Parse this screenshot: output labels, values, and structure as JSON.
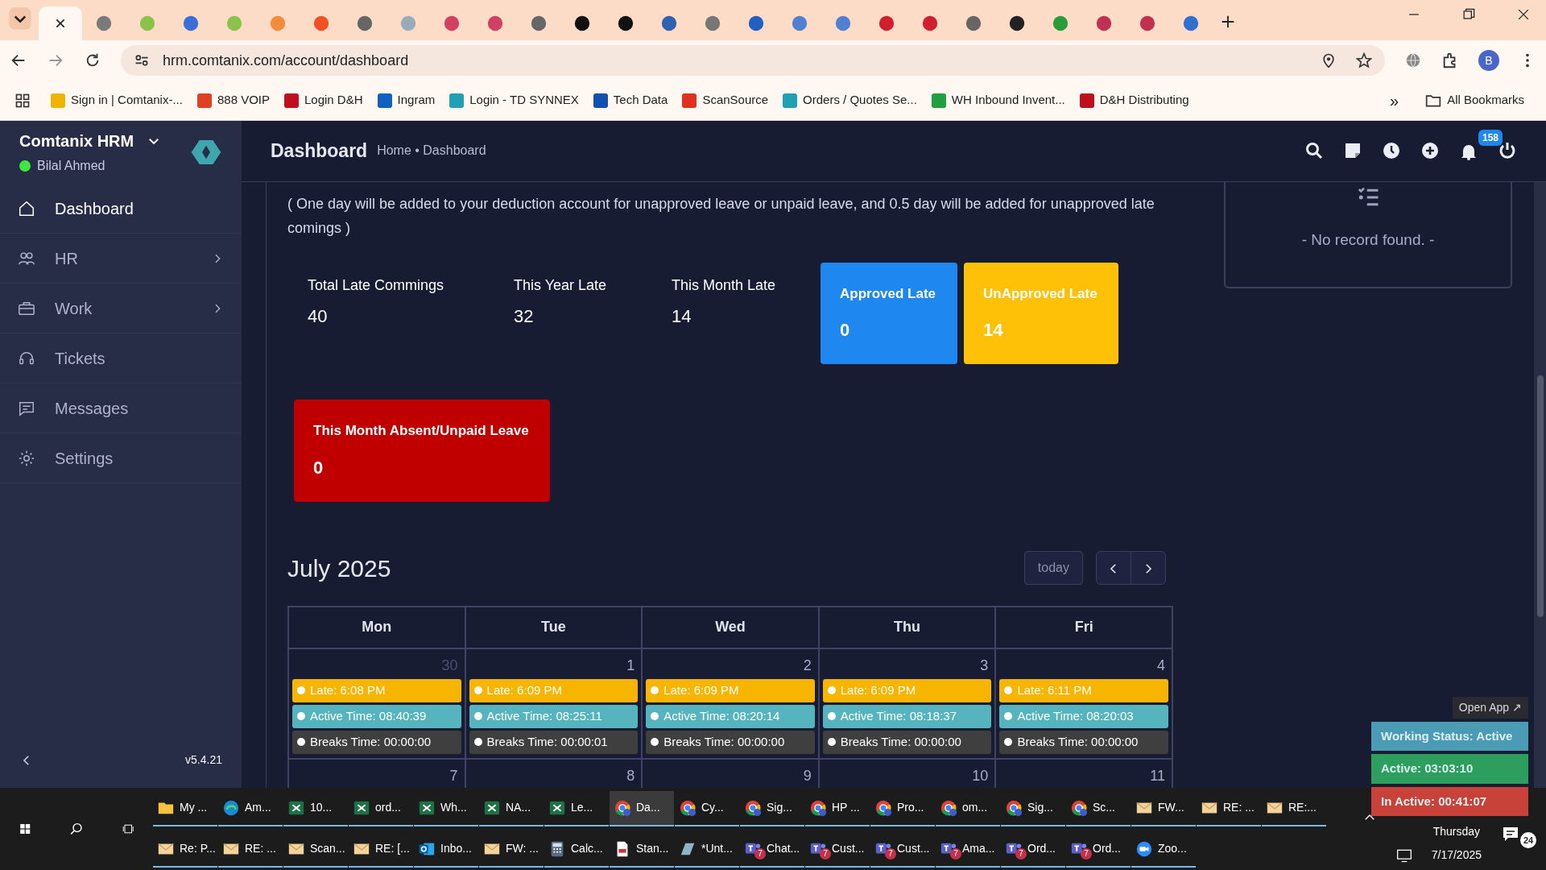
{
  "browser": {
    "tabs": [
      {
        "selected": true
      },
      {
        "selected": false,
        "color": "#7a7a7a"
      },
      {
        "selected": false,
        "color": "#8bc34a"
      },
      {
        "selected": false,
        "color": "#3a6fd8"
      },
      {
        "selected": false,
        "color": "#8bc34a"
      },
      {
        "selected": false,
        "color": "#f08c3a"
      },
      {
        "selected": false,
        "color": "#f25022"
      },
      {
        "selected": false,
        "color": "#666666"
      },
      {
        "selected": false,
        "color": "#99aabb"
      },
      {
        "selected": false,
        "color": "#d04060"
      },
      {
        "selected": false,
        "color": "#d04060"
      },
      {
        "selected": false,
        "color": "#666666"
      },
      {
        "selected": false,
        "color": "#111111"
      },
      {
        "selected": false,
        "color": "#111111"
      },
      {
        "selected": false,
        "color": "#3060b0"
      },
      {
        "selected": false,
        "color": "#777777"
      },
      {
        "selected": false,
        "color": "#2060c0"
      },
      {
        "selected": false,
        "color": "#5080d0"
      },
      {
        "selected": false,
        "color": "#5080d0"
      },
      {
        "selected": false,
        "color": "#d02030"
      },
      {
        "selected": false,
        "color": "#d02030"
      },
      {
        "selected": false,
        "color": "#666666"
      },
      {
        "selected": false,
        "color": "#222222"
      },
      {
        "selected": false,
        "color": "#2a9d3a"
      },
      {
        "selected": false,
        "color": "#c03050"
      },
      {
        "selected": false,
        "color": "#c03050"
      },
      {
        "selected": false,
        "color": "#3070d0"
      }
    ],
    "url": "hrm.comtanix.com/account/dashboard",
    "profile": "B",
    "bookmarks": [
      {
        "label": "Sign in | Comtanix-...",
        "color": "#f0b400"
      },
      {
        "label": "888 VOIP",
        "color": "#e04020"
      },
      {
        "label": "Login D&H",
        "color": "#c01020"
      },
      {
        "label": "Ingram",
        "color": "#1060c0"
      },
      {
        "label": "Login - TD SYNNEX",
        "color": "#20a0b0"
      },
      {
        "label": "Tech Data",
        "color": "#1050b0"
      },
      {
        "label": "ScanSource",
        "color": "#e03020"
      },
      {
        "label": "Orders / Quotes Se...",
        "color": "#20a0b0"
      },
      {
        "label": "WH Inbound Invent...",
        "color": "#20a040"
      },
      {
        "label": "D&H Distributing",
        "color": "#c01020"
      }
    ],
    "more": "»",
    "all_bookmarks": "All Bookmarks"
  },
  "sidebar": {
    "brand": "Comtanix HRM",
    "user": "Bilal Ahmed",
    "online": true,
    "items": [
      {
        "label": "Dashboard",
        "kind": "home",
        "selected": true,
        "submenu": false
      },
      {
        "label": "HR",
        "kind": "people",
        "selected": false,
        "submenu": true
      },
      {
        "label": "Work",
        "kind": "briefcase",
        "selected": false,
        "submenu": true
      },
      {
        "label": "Tickets",
        "kind": "headset",
        "selected": false,
        "submenu": false
      },
      {
        "label": "Messages",
        "kind": "message",
        "selected": false,
        "submenu": false
      },
      {
        "label": "Settings",
        "kind": "gear",
        "selected": false,
        "submenu": false
      }
    ],
    "version": "v5.4.21"
  },
  "header": {
    "title": "Dashboard",
    "breadcrumb": "Home • Dashboard",
    "notifications": "158"
  },
  "attendance": {
    "note": "( One day will be added to your deduction account for unapproved leave or unpaid leave, and 0.5 day will be added for unapproved late comings )",
    "stats": [
      {
        "kind": "plain",
        "label": "Total Late Commings",
        "value": "40"
      },
      {
        "kind": "plain",
        "label": "This Year Late",
        "value": "32"
      },
      {
        "kind": "plain",
        "label": "This Month Late",
        "value": "14"
      },
      {
        "kind": "card",
        "label": "Approved Late",
        "value": "0",
        "color": "#1e87f0"
      },
      {
        "kind": "card",
        "label": "UnApproved Late",
        "value": "14",
        "color": "#ffc107"
      },
      {
        "kind": "card",
        "label": "This Month Absent/Unpaid Leave",
        "value": "0",
        "color": "#c00000"
      }
    ]
  },
  "calendar": {
    "title": "July 2025",
    "today": "today",
    "days": [
      "Mon",
      "Tue",
      "Wed",
      "Thu",
      "Fri"
    ],
    "weeks": [
      [
        {
          "date": "30",
          "other_month": true,
          "events": [
            {
              "kind": "late",
              "text": "Late: 6:08 PM"
            },
            {
              "kind": "active",
              "text": "Active Time: 08:40:39"
            },
            {
              "kind": "breaks",
              "text": "Breaks Time: 00:00:00"
            }
          ]
        },
        {
          "date": "1",
          "other_month": false,
          "events": [
            {
              "kind": "late",
              "text": "Late: 6:09 PM"
            },
            {
              "kind": "active",
              "text": "Active Time: 08:25:11"
            },
            {
              "kind": "breaks",
              "text": "Breaks Time: 00:00:01"
            }
          ]
        },
        {
          "date": "2",
          "other_month": false,
          "events": [
            {
              "kind": "late",
              "text": "Late: 6:09 PM"
            },
            {
              "kind": "active",
              "text": "Active Time: 08:20:14"
            },
            {
              "kind": "breaks",
              "text": "Breaks Time: 00:00:00"
            }
          ]
        },
        {
          "date": "3",
          "other_month": false,
          "events": [
            {
              "kind": "late",
              "text": "Late: 6:09 PM"
            },
            {
              "kind": "active",
              "text": "Active Time: 08:18:37"
            },
            {
              "kind": "breaks",
              "text": "Breaks Time: 00:00:00"
            }
          ]
        },
        {
          "date": "4",
          "other_month": false,
          "events": [
            {
              "kind": "late",
              "text": "Late: 6:11 PM"
            },
            {
              "kind": "active",
              "text": "Active Time: 08:20:03"
            },
            {
              "kind": "breaks",
              "text": "Breaks Time: 00:00:00"
            }
          ]
        }
      ],
      [
        {
          "date": "7",
          "other_month": false
        },
        {
          "date": "8",
          "other_month": false
        },
        {
          "date": "9",
          "other_month": false
        },
        {
          "date": "10",
          "other_month": false
        },
        {
          "date": "11",
          "other_month": false
        }
      ]
    ]
  },
  "side_panel": {
    "empty_text": "- No record found. -"
  },
  "tracker": {
    "open_app": "Open App ↗",
    "rows": [
      {
        "text": "Working Status: Active",
        "color": "#4a9bb3"
      },
      {
        "text": "Active: 03:03:10",
        "color": "#2e9e5e"
      },
      {
        "text": "In Active: 00:41:07",
        "color": "#c9423a"
      }
    ]
  },
  "taskbar": {
    "rows": [
      [
        {
          "label": "My ...",
          "kind": "folder",
          "selected": false
        },
        {
          "label": "Am...",
          "kind": "edge",
          "selected": false
        },
        {
          "label": "10...",
          "kind": "excel",
          "selected": false
        },
        {
          "label": "ord...",
          "kind": "excel",
          "selected": false
        },
        {
          "label": "Wh...",
          "kind": "excel",
          "selected": false
        },
        {
          "label": "NA...",
          "kind": "excel",
          "selected": false
        },
        {
          "label": "Le...",
          "kind": "excel",
          "selected": false
        },
        {
          "label": "Da...",
          "kind": "chrome",
          "selected": true
        },
        {
          "label": "Cy...",
          "kind": "chrome",
          "selected": false
        },
        {
          "label": "Sig...",
          "kind": "chrome",
          "selected": false
        },
        {
          "label": "HP ...",
          "kind": "chrome",
          "selected": false
        },
        {
          "label": "Pro...",
          "kind": "chrome",
          "selected": false
        },
        {
          "label": "om...",
          "kind": "chrome",
          "selected": false
        },
        {
          "label": "Sig...",
          "kind": "chrome",
          "selected": false
        },
        {
          "label": "Sc...",
          "kind": "chrome",
          "selected": false
        },
        {
          "label": "FW...",
          "kind": "mail",
          "selected": false
        },
        {
          "label": "RE: ...",
          "kind": "mail",
          "selected": false
        },
        {
          "label": "RE:...",
          "kind": "mail",
          "selected": false
        }
      ],
      [
        {
          "label": "Re: P...",
          "kind": "mail",
          "selected": false
        },
        {
          "label": "RE: ...",
          "kind": "mail",
          "selected": false
        },
        {
          "label": "Scan...",
          "kind": "mail",
          "selected": false
        },
        {
          "label": "RE: [...",
          "kind": "mail",
          "selected": false
        },
        {
          "label": "Inbo...",
          "kind": "outlook",
          "selected": false
        },
        {
          "label": "FW: ...",
          "kind": "mail",
          "selected": false
        },
        {
          "label": "Calc...",
          "kind": "calc",
          "selected": false
        },
        {
          "label": "Stan...",
          "kind": "pdf",
          "selected": false
        },
        {
          "label": "*Unt...",
          "kind": "app",
          "selected": false
        },
        {
          "label": "Chat...",
          "kind": "teams",
          "selected": false,
          "badge": "7"
        },
        {
          "label": "Cust...",
          "kind": "teams",
          "selected": false,
          "badge": "7"
        },
        {
          "label": "Cust...",
          "kind": "teams",
          "selected": false,
          "badge": "7"
        },
        {
          "label": "Ama...",
          "kind": "teams",
          "selected": false,
          "badge": "7"
        },
        {
          "label": "Ord...",
          "kind": "teams",
          "selected": false,
          "badge": "7"
        },
        {
          "label": "Ord...",
          "kind": "teams",
          "selected": false,
          "badge": "7"
        },
        {
          "label": "Zoo...",
          "kind": "zoom",
          "selected": false
        }
      ]
    ],
    "day": "Thursday",
    "date": "7/17/2025",
    "notifications": "24"
  }
}
